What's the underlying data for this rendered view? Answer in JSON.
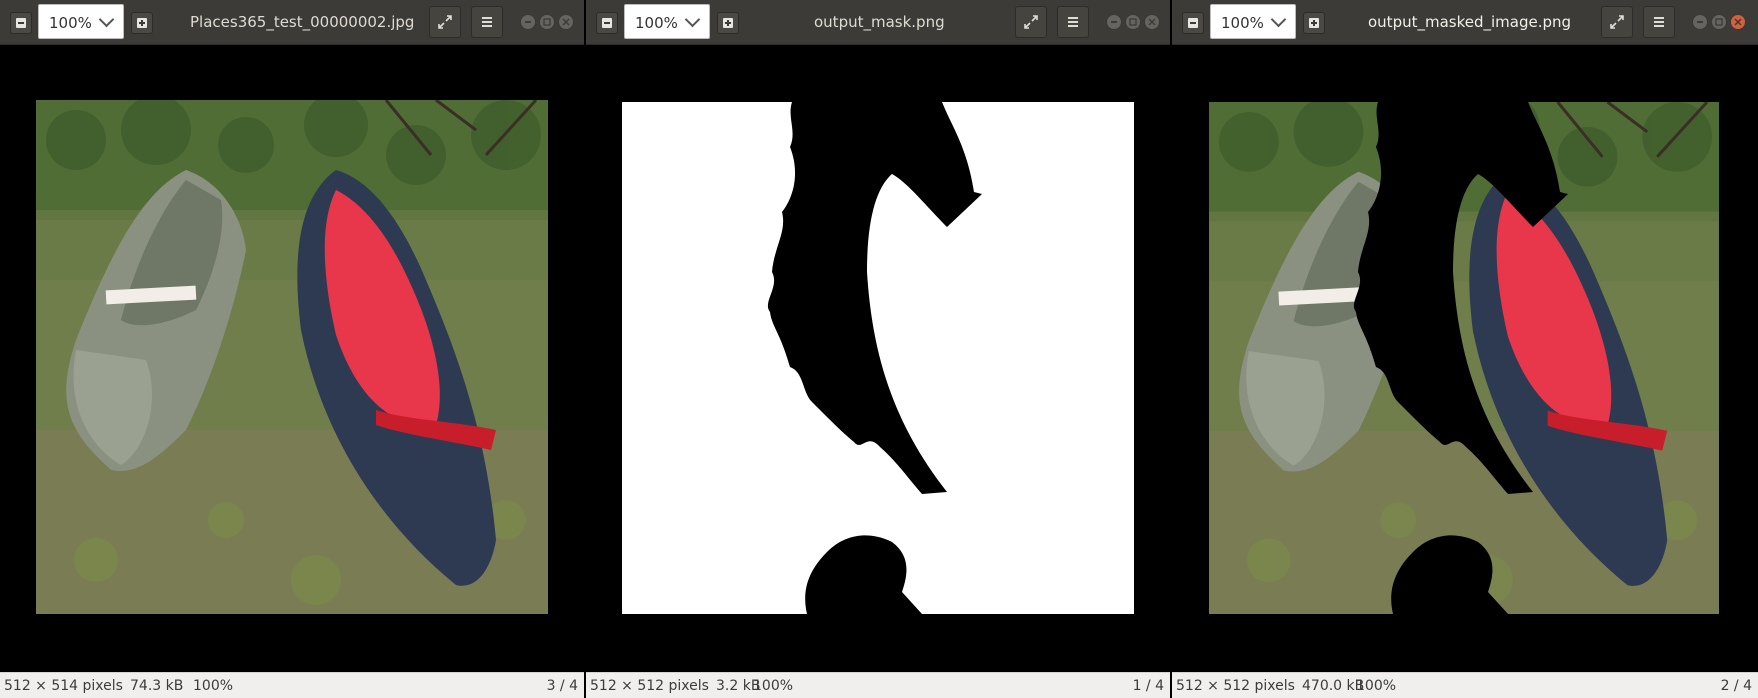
{
  "windows": [
    {
      "zoom_value": "100%",
      "title": "Places365_test_00000002.jpg",
      "status": {
        "dimensions": "512 × 514 pixels",
        "size": "74.3 kB",
        "zoom": "100%",
        "index": "3 / 4"
      }
    },
    {
      "zoom_value": "100%",
      "title": "output_mask.png",
      "status": {
        "dimensions": "512 × 512 pixels",
        "size": "3.2 kB",
        "zoom": "100%",
        "index": "1 / 4"
      }
    },
    {
      "zoom_value": "100%",
      "title": "output_masked_image.png",
      "status": {
        "dimensions": "512 × 512 pixels",
        "size": "470.0 kB",
        "zoom": "100%",
        "index": "2 / 4"
      }
    }
  ],
  "icons": {
    "zoom_out": "minus-icon",
    "zoom_in": "plus-icon",
    "fullscreen": "fullscreen-icon",
    "menu": "hamburger-menu-icon",
    "minimize": "minimize-icon",
    "maximize": "maximize-icon",
    "close": "close-icon"
  },
  "colors": {
    "titlebar": "#3c3b37",
    "statusbar": "#f0efed",
    "grass": "#5d7a3a",
    "kayak_gray": "#8a9181",
    "kayak_red": "#e8374a",
    "kayak_navy": "#2d3a52"
  }
}
